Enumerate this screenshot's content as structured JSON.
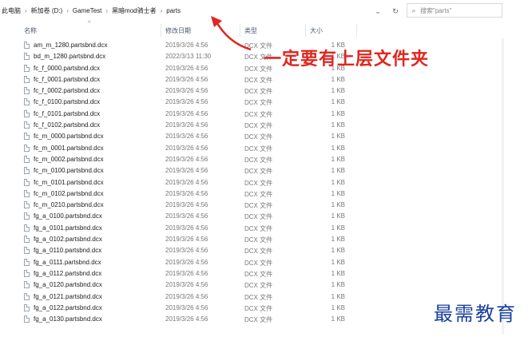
{
  "address": {
    "crumbs": [
      "此电脑",
      "新加卷 (D:)",
      "GameTest",
      "黑暗mod骑士者",
      "parts"
    ]
  },
  "search": {
    "placeholder": "搜索\"parts\""
  },
  "columns": {
    "name": "名称",
    "date": "修改日期",
    "type": "类型",
    "size": "大小"
  },
  "files": [
    {
      "name": "am_m_1280.partsbnd.dcx",
      "date": "2019/3/26 4:56",
      "type": "DCX 文件",
      "size": "1 KB"
    },
    {
      "name": "bd_m_1280.partsbnd.dcx",
      "date": "2022/3/13 11:30",
      "type": "DCX 文件",
      "size": "1 KB"
    },
    {
      "name": "fc_f_0000.partsbnd.dcx",
      "date": "2019/3/26 4:56",
      "type": "DCX 文件",
      "size": "1 KB"
    },
    {
      "name": "fc_f_0001.partsbnd.dcx",
      "date": "2019/3/26 4:56",
      "type": "DCX 文件",
      "size": "1 KB"
    },
    {
      "name": "fc_f_0002.partsbnd.dcx",
      "date": "2019/3/26 4:56",
      "type": "DCX 文件",
      "size": "1 KB"
    },
    {
      "name": "fc_f_0100.partsbnd.dcx",
      "date": "2019/3/26 4:56",
      "type": "DCX 文件",
      "size": "1 KB"
    },
    {
      "name": "fc_f_0101.partsbnd.dcx",
      "date": "2019/3/26 4:56",
      "type": "DCX 文件",
      "size": "1 KB"
    },
    {
      "name": "fc_f_0102.partsbnd.dcx",
      "date": "2019/3/26 4:56",
      "type": "DCX 文件",
      "size": "1 KB"
    },
    {
      "name": "fc_m_0000.partsbnd.dcx",
      "date": "2019/3/26 4:56",
      "type": "DCX 文件",
      "size": "1 KB"
    },
    {
      "name": "fc_m_0001.partsbnd.dcx",
      "date": "2019/3/26 4:56",
      "type": "DCX 文件",
      "size": "1 KB"
    },
    {
      "name": "fc_m_0002.partsbnd.dcx",
      "date": "2019/3/26 4:56",
      "type": "DCX 文件",
      "size": "1 KB"
    },
    {
      "name": "fc_m_0100.partsbnd.dcx",
      "date": "2019/3/26 4:56",
      "type": "DCX 文件",
      "size": "1 KB"
    },
    {
      "name": "fc_m_0101.partsbnd.dcx",
      "date": "2019/3/26 4:56",
      "type": "DCX 文件",
      "size": "1 KB"
    },
    {
      "name": "fc_m_0102.partsbnd.dcx",
      "date": "2019/3/26 4:56",
      "type": "DCX 文件",
      "size": "1 KB"
    },
    {
      "name": "fc_m_0210.partsbnd.dcx",
      "date": "2019/3/26 4:56",
      "type": "DCX 文件",
      "size": "1 KB"
    },
    {
      "name": "fg_a_0100.partsbnd.dcx",
      "date": "2019/3/26 4:56",
      "type": "DCX 文件",
      "size": "1 KB"
    },
    {
      "name": "fg_a_0101.partsbnd.dcx",
      "date": "2019/3/26 4:56",
      "type": "DCX 文件",
      "size": "1 KB"
    },
    {
      "name": "fg_a_0102.partsbnd.dcx",
      "date": "2019/3/26 4:56",
      "type": "DCX 文件",
      "size": "1 KB"
    },
    {
      "name": "fg_a_0110.partsbnd.dcx",
      "date": "2019/3/26 4:56",
      "type": "DCX 文件",
      "size": "1 KB"
    },
    {
      "name": "fg_a_0111.partsbnd.dcx",
      "date": "2019/3/26 4:56",
      "type": "DCX 文件",
      "size": "1 KB"
    },
    {
      "name": "fg_a_0112.partsbnd.dcx",
      "date": "2019/3/26 4:56",
      "type": "DCX 文件",
      "size": "1 KB"
    },
    {
      "name": "fg_a_0120.partsbnd.dcx",
      "date": "2019/3/26 4:56",
      "type": "DCX 文件",
      "size": "1 KB"
    },
    {
      "name": "fg_a_0121.partsbnd.dcx",
      "date": "2019/3/26 4:56",
      "type": "DCX 文件",
      "size": "1 KB"
    },
    {
      "name": "fg_a_0122.partsbnd.dcx",
      "date": "2019/3/26 4:56",
      "type": "DCX 文件",
      "size": "1 KB"
    },
    {
      "name": "fg_a_0130.partsbnd.dcx",
      "date": "2019/3/26 4:56",
      "type": "DCX 文件",
      "size": "1 KB"
    }
  ],
  "annotation": {
    "text": "一定要有上层文件夹",
    "color": "#e0261f"
  },
  "watermark": {
    "text": "最需教育",
    "color": "#1a3f9e"
  }
}
